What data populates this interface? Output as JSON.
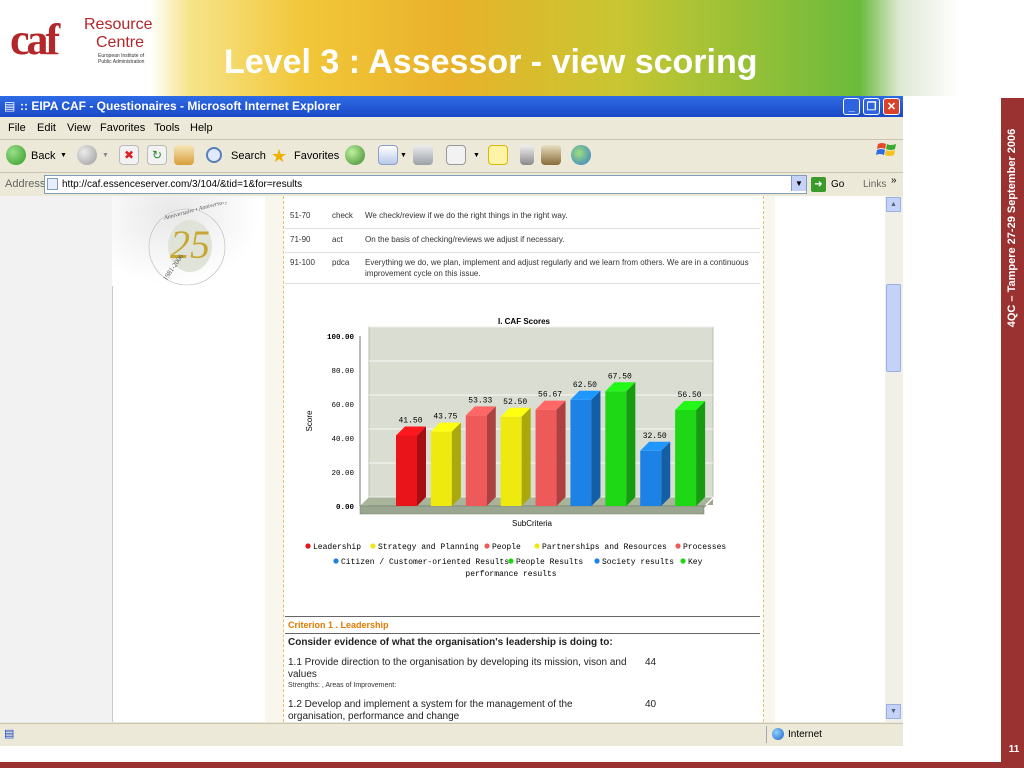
{
  "slide": {
    "title": "Level 3 : Assessor - view scoring",
    "logo": {
      "mark": "caf",
      "line1": "Resource",
      "line2": "Centre",
      "tagline": "European Institute of Public Administration"
    },
    "side_text": "4QC – Tampere 27-29 September 2006",
    "slide_number": "11"
  },
  "browser": {
    "window_title": ":: EIPA CAF - Questionaires - Microsoft Internet Explorer",
    "menu": [
      "File",
      "Edit",
      "View",
      "Favorites",
      "Tools",
      "Help"
    ],
    "toolbar": {
      "back": "Back",
      "search": "Search",
      "favorites": "Favorites"
    },
    "address": {
      "label": "Address",
      "url": "http://caf.essenceserver.com/3/104/&tid=1&for=results",
      "go": "Go",
      "links": "Links"
    },
    "status": {
      "zone": "Internet"
    }
  },
  "page": {
    "anniversary": {
      "number": "25",
      "text_left": "1981-2006",
      "text_arc": "Anniversaire • Anniversary"
    },
    "scale_rows": [
      {
        "range": "51-70",
        "phase": "check",
        "text": "We check/review if we do the right things in the right way."
      },
      {
        "range": "71-90",
        "phase": "act",
        "text": "On the basis of checking/reviews we adjust if necessary."
      },
      {
        "range": "91-100",
        "phase": "pdca",
        "text": "Everything we do, we plan, implement and adjust regularly and we learn from others. We are in a continuous improvement cycle on this issue."
      }
    ],
    "criterion": {
      "header": "Criterion 1 . Leadership",
      "consider": "Consider evidence of what the organisation's leadership is doing to:",
      "subs": [
        {
          "text": "1.1 Provide direction to the organisation by developing its mission, vison and values",
          "score": "44"
        },
        {
          "text": "1.2 Develop and implement a system for the management of the organisation, performance and change",
          "score": "40"
        }
      ],
      "strengths_label": "Strengths: , Areas of Improvement:"
    }
  },
  "chart_data": {
    "type": "bar",
    "title": "I. CAF Scores",
    "xlabel": "SubCriteria",
    "ylabel": "Score",
    "ylim": [
      0,
      100
    ],
    "yticks": [
      "0.00",
      "20.00",
      "40.00",
      "60.00",
      "80.00",
      "100.00"
    ],
    "categories": [
      "Leadership",
      "Strategy and Planning",
      "People",
      "Partnerships and Resources",
      "Processes",
      "Citizen / Customer-oriented Results",
      "People Results",
      "Society results",
      "Key performance results"
    ],
    "bar_labels": [
      "41.50",
      "43.75",
      "53.33",
      "52.50",
      "56.67",
      "62.50",
      "67.50",
      "32.50",
      "56.50"
    ],
    "values": [
      41.5,
      43.75,
      53.33,
      52.5,
      56.67,
      62.5,
      67.5,
      32.5,
      56.5
    ],
    "colors": [
      "#e8141a",
      "#eeea10",
      "#ee5a5a",
      "#eeea10",
      "#ee5a5a",
      "#1c82e6",
      "#1ed816",
      "#1c82e6",
      "#1ed816"
    ],
    "legend": [
      {
        "label": "Leadership",
        "color": "#e8141a"
      },
      {
        "label": "Strategy and Planning",
        "color": "#eeea10"
      },
      {
        "label": "People",
        "color": "#ee5a5a"
      },
      {
        "label": "Partnerships and Resources",
        "color": "#eeea10"
      },
      {
        "label": "Processes",
        "color": "#ee5a5a"
      },
      {
        "label": "Citizen / Customer-oriented Results",
        "color": "#1c82e6"
      },
      {
        "label": "People Results",
        "color": "#1ed816"
      },
      {
        "label": "Society results",
        "color": "#1c82e6"
      },
      {
        "label": "Key performance results",
        "color": "#1ed816"
      }
    ],
    "grid": true,
    "legend_position": "bottom"
  }
}
